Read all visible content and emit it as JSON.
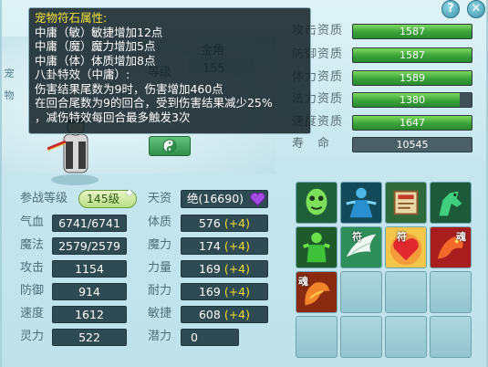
{
  "window": {
    "help_label": "?",
    "close_label": "✕"
  },
  "background": {
    "side_tag_1": "宠",
    "side_tag_2": "物",
    "name_label": "金角",
    "level_label": "等级",
    "level_value": "155"
  },
  "tooltip": {
    "title": "宠物符石属性:",
    "lines": [
      {
        "label": "中庸（敏）:",
        "text": "敏捷增加12点"
      },
      {
        "label": "中庸（魔）:",
        "text": "魔力增加5点"
      },
      {
        "label": "中庸（体）:",
        "text": "体质增加8点"
      }
    ],
    "effect_header": "八卦特效（中庸）:",
    "effect_1": "伤害结果尾数为9时，伤害增加460点",
    "effect_2": "在回合尾数为9的回合，受到伤害结果减少25%",
    "effect_3": "，减伤特效每回合最多触发3次"
  },
  "aptitudes": [
    {
      "label": "攻击资质",
      "value": "1587",
      "fill_percent": 100
    },
    {
      "label": "防御资质",
      "value": "1587",
      "fill_percent": 100
    },
    {
      "label": "体力资质",
      "value": "1589",
      "fill_percent": 100
    },
    {
      "label": "法力资质",
      "value": "1380",
      "fill_percent": 90
    },
    {
      "label": "速度资质",
      "value": "1647",
      "fill_percent": 100
    }
  ],
  "life": {
    "label": "寿　命",
    "value": "10545"
  },
  "stats": {
    "battle_level_label": "参战等级",
    "battle_level_value": "145级",
    "talent_label": "天资",
    "talent_value": "绝(16690)",
    "hp_label": "气血",
    "hp_value": "6741/6741",
    "mp_label": "魔法",
    "mp_value": "2579/2579",
    "atk_label": "攻击",
    "atk_value": "1154",
    "def_label": "防御",
    "def_value": "914",
    "spd_label": "速度",
    "spd_value": "1612",
    "spirit_label": "灵力",
    "spirit_value": "522",
    "con_label": "体质",
    "con_value": "576",
    "con_bonus": "(+4)",
    "mag_label": "魔力",
    "mag_value": "174",
    "mag_bonus": "(+4)",
    "str_label": "力量",
    "str_value": "169",
    "str_bonus": "(+4)",
    "end_label": "耐力",
    "end_value": "169",
    "end_bonus": "(+4)",
    "agi_label": "敏捷",
    "agi_value": "608",
    "agi_bonus": "(+4)",
    "pot_label": "潜力",
    "pot_value": "0"
  },
  "skills": {
    "slots": [
      {
        "icon": "green-ghost-skill-icon",
        "mark": ""
      },
      {
        "icon": "blue-figure-skill-icon",
        "mark": ""
      },
      {
        "icon": "scroll-skill-icon",
        "mark": ""
      },
      {
        "icon": "green-horse-skill-icon",
        "mark": ""
      },
      {
        "icon": "green-warrior-skill-icon",
        "mark": ""
      },
      {
        "icon": "white-wing-skill-icon",
        "mark": "符"
      },
      {
        "icon": "red-heart-skill-icon",
        "mark": "符"
      },
      {
        "icon": "red-dragon-skill-icon",
        "mark": "魂"
      },
      {
        "icon": "orange-dragon-skill-icon",
        "mark": "魂"
      }
    ]
  },
  "colors": {
    "bonus": "#f2dd2a",
    "tooltip_title": "#f6e53a",
    "bar_fill": "#3aa23a"
  }
}
